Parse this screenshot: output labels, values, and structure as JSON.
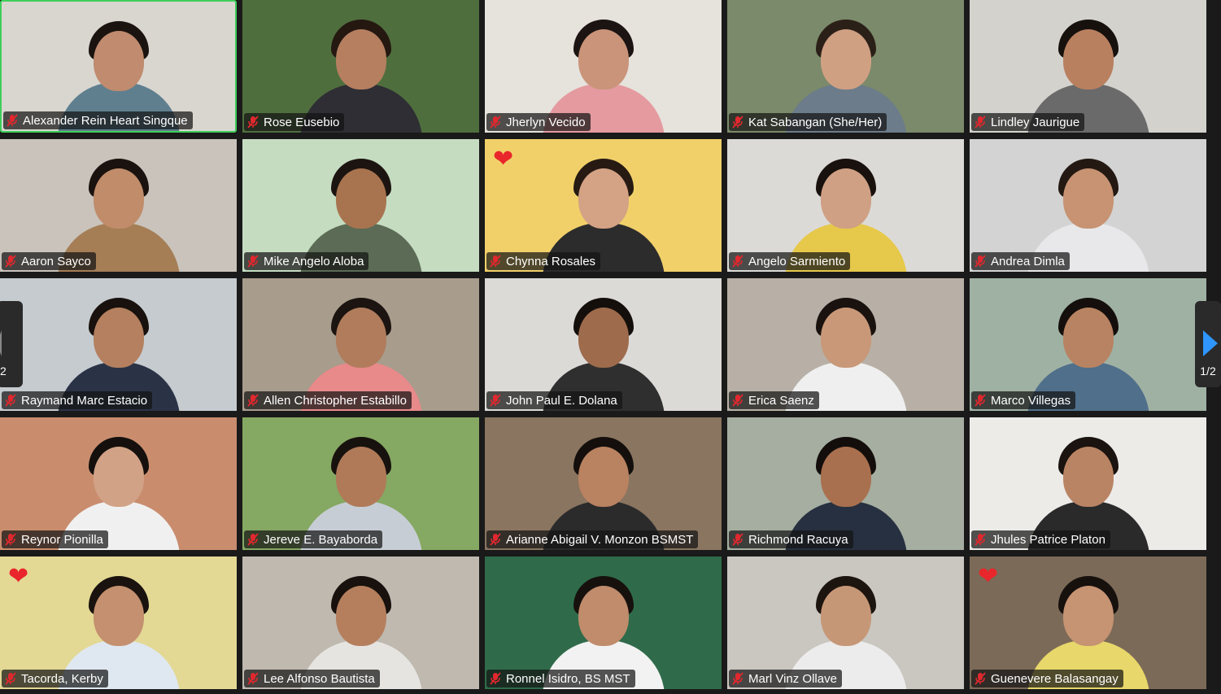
{
  "gallery": {
    "page_indicator_left": "2",
    "page_indicator_right": "1/2",
    "participants": [
      {
        "name": "Alexander Rein Heart Singque",
        "bg": "#d9d6d0",
        "body": "#5f7f8f",
        "skin": "#c08b6e",
        "hair": "#1b1310",
        "active": true
      },
      {
        "name": "Rose Eusebio",
        "bg": "#4f6e3d",
        "body": "#2e2e34",
        "skin": "#b57f60",
        "hair": "#241811"
      },
      {
        "name": "Jherlyn Vecido",
        "bg": "#e6e2dc",
        "body": "#e49a9f",
        "skin": "#c99479",
        "hair": "#1b1412"
      },
      {
        "name": "Kat Sabangan (She/Her)",
        "bg": "#7b8a6a",
        "body": "#6c7c8a",
        "skin": "#d0a083",
        "hair": "#2b2018"
      },
      {
        "name": "Lindley Jaurigue",
        "bg": "#d4d2cd",
        "body": "#6a6a6a",
        "skin": "#b98060",
        "hair": "#17110e"
      },
      {
        "name": "Aaron Sayco",
        "bg": "#c9c3bb",
        "body": "#a57e56",
        "skin": "#c08c6a",
        "hair": "#1a120e"
      },
      {
        "name": "Mike Angelo Aloba",
        "bg": "#c5dcc0",
        "body": "#5c6b55",
        "skin": "#a8744f",
        "hair": "#1c1410"
      },
      {
        "name": "Chynna Rosales",
        "bg": "#f1d06a",
        "body": "#2c2c2c",
        "skin": "#d4a284",
        "hair": "#261a13",
        "heart": true
      },
      {
        "name": "Angelo Sarmiento",
        "bg": "#dcdad6",
        "body": "#e6c84a",
        "skin": "#cfa084",
        "hair": "#18110d"
      },
      {
        "name": "Andrea Dimla",
        "bg": "#d2d3d2",
        "body": "#e8e8ea",
        "skin": "#c79373",
        "hair": "#241812"
      },
      {
        "name": "Raymand Marc Estacio",
        "bg": "#c6cbcf",
        "body": "#2a3346",
        "skin": "#b4805f",
        "hair": "#18110d"
      },
      {
        "name": "Allen Christopher Estabillo",
        "bg": "#a89c8c",
        "body": "#e8898a",
        "skin": "#b07c5c",
        "hair": "#1b1410"
      },
      {
        "name": "John Paul E. Dolana",
        "bg": "#dcdad7",
        "body": "#2f2f2f",
        "skin": "#9e6b4c",
        "hair": "#150f0c"
      },
      {
        "name": "Erica Saenz",
        "bg": "#b8b0a6",
        "body": "#efefef",
        "skin": "#c89878",
        "hair": "#1a120f"
      },
      {
        "name": "Marco Villegas",
        "bg": "#9fb1a3",
        "body": "#4f6f8a",
        "skin": "#b88362",
        "hair": "#140f0c"
      },
      {
        "name": "Reynor Pionilla",
        "bg": "#c98d6e",
        "body": "#f0f0f0",
        "skin": "#d1a286",
        "hair": "#15100d"
      },
      {
        "name": "Jereve E. Bayaborda",
        "bg": "#85a862",
        "body": "#c7cdd4",
        "skin": "#b07a58",
        "hair": "#18120e"
      },
      {
        "name": "Arianne Abigail V. Monzon BSMST",
        "bg": "#8a7560",
        "body": "#2b2b2b",
        "skin": "#b98261",
        "hair": "#140f0c"
      },
      {
        "name": "Richmond Racuya",
        "bg": "#a5aea0",
        "body": "#273040",
        "skin": "#a9704f",
        "hair": "#130e0b"
      },
      {
        "name": "Jhules Patrice Platon",
        "bg": "#ecebe8",
        "body": "#2a2a2a",
        "skin": "#b98464",
        "hair": "#1a130f"
      },
      {
        "name": "Tacorda, Kerby",
        "bg": "#e3d894",
        "body": "#dfe8f0",
        "skin": "#c4906f",
        "hair": "#1a120e",
        "heart": true
      },
      {
        "name": "Lee Alfonso Bautista",
        "bg": "#bfb9b0",
        "body": "#e6e4e0",
        "skin": "#b57f5e",
        "hair": "#18110d"
      },
      {
        "name": "Ronnel Isidro, BS MST",
        "bg": "#2f6b4a",
        "body": "#f2f2f2",
        "skin": "#c08c6c",
        "hair": "#17110e"
      },
      {
        "name": "Marl Vinz Ollave",
        "bg": "#cac6c0",
        "body": "#ececec",
        "skin": "#c69777",
        "hair": "#1c140f"
      },
      {
        "name": "Guenevere Balasangay",
        "bg": "#7c6a58",
        "body": "#e8d76a",
        "skin": "#c69373",
        "hair": "#17110e",
        "heart": true
      }
    ]
  }
}
